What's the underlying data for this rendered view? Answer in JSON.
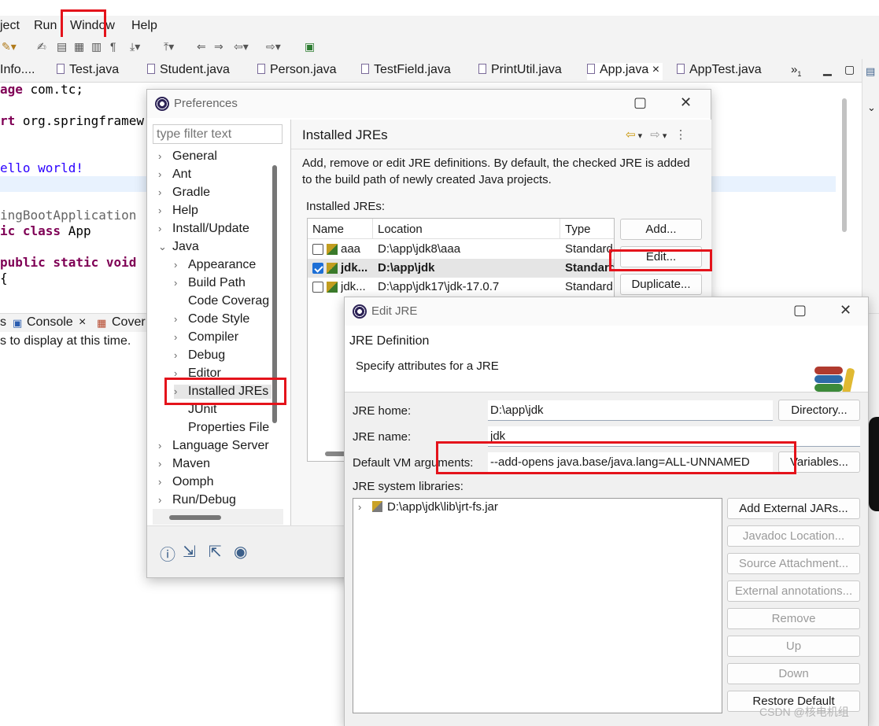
{
  "menu": {
    "project_fragment": "ject",
    "run": "Run",
    "window": "Window",
    "help": "Help"
  },
  "editor_tabs": [
    {
      "label": "Info...."
    },
    {
      "label": "Test.java"
    },
    {
      "label": "Student.java"
    },
    {
      "label": "Person.java"
    },
    {
      "label": "TestField.java"
    },
    {
      "label": "PrintUtil.java"
    },
    {
      "label": "App.java",
      "close": "×"
    },
    {
      "label": "AppTest.java"
    }
  ],
  "tab_overflow": "»",
  "tab_overflow_count": "1",
  "code": {
    "line1_kw": "age",
    "line1_rest": " com.tc;",
    "line2_kw": "rt",
    "line2_rest": " org.springframew",
    "line3": "ello world!",
    "line4": "ingBootApplication",
    "line5_kw": "ic class",
    "line5_rest": " App",
    "line6_kw": "public static void",
    "line7": "{"
  },
  "bottom_tabs": {
    "s": "s",
    "console": "Console",
    "console_close": "×",
    "coverage": "Cover"
  },
  "console_text": "s to display at this time.",
  "prefs": {
    "title": "Preferences",
    "filter_placeholder": "type filter text",
    "tree": [
      {
        "label": "General",
        "chev": "›"
      },
      {
        "label": "Ant",
        "chev": "›"
      },
      {
        "label": "Gradle",
        "chev": "›"
      },
      {
        "label": "Help",
        "chev": "›"
      },
      {
        "label": "Install/Update",
        "chev": "›"
      },
      {
        "label": "Java",
        "chev": "⌄"
      },
      {
        "label": "Appearance",
        "chev": "›"
      },
      {
        "label": "Build Path",
        "chev": "›"
      },
      {
        "label": "Code Coverag",
        "chev": ""
      },
      {
        "label": "Code Style",
        "chev": "›"
      },
      {
        "label": "Compiler",
        "chev": "›"
      },
      {
        "label": "Debug",
        "chev": "›"
      },
      {
        "label": "Editor",
        "chev": "›"
      },
      {
        "label": "Installed JREs",
        "chev": "›"
      },
      {
        "label": "JUnit",
        "chev": ""
      },
      {
        "label": "Properties File",
        "chev": ""
      },
      {
        "label": "Language Server",
        "chev": "›"
      },
      {
        "label": "Maven",
        "chev": "›"
      },
      {
        "label": "Oomph",
        "chev": "›"
      },
      {
        "label": "Run/Debug",
        "chev": "›"
      }
    ],
    "page_title": "Installed JREs",
    "description": "Add, remove or edit JRE definitions. By default, the checked JRE is added to the build path of newly created Java projects.",
    "installed_label": "Installed JREs:",
    "columns": {
      "name": "Name",
      "location": "Location",
      "type": "Type"
    },
    "rows": [
      {
        "name": "aaa",
        "location": "D:\\app\\jdk8\\aaa",
        "type": "Standard",
        "checked": false
      },
      {
        "name": "jdk...",
        "location": "D:\\app\\jdk",
        "type": "Standard",
        "checked": true
      },
      {
        "name": "jdk...",
        "location": "D:\\app\\jdk17\\jdk-17.0.7",
        "type": "Standard",
        "checked": false
      }
    ],
    "buttons": {
      "add": "Add...",
      "edit": "Edit...",
      "duplicate": "Duplicate..."
    }
  },
  "edit_jre": {
    "title": "Edit JRE",
    "heading": "JRE Definition",
    "subheading": "Specify attributes for a JRE",
    "jre_home_label": "JRE home:",
    "jre_home_value": "D:\\app\\jdk",
    "jre_name_label": "JRE name:",
    "jre_name_value": "jdk",
    "vm_args_label": "Default VM arguments:",
    "vm_args_value": "--add-opens java.base/java.lang=ALL-UNNAMED",
    "directory_button": "Directory...",
    "variables_button": "Variables...",
    "libraries_label": "JRE system libraries:",
    "library_item": "D:\\app\\jdk\\lib\\jrt-fs.jar",
    "buttons": {
      "add_external_jars": "Add External JARs...",
      "javadoc_location": "Javadoc Location...",
      "source_attachment": "Source Attachment...",
      "external_annotations": "External annotations...",
      "remove": "Remove",
      "up": "Up",
      "down": "Down",
      "restore_default": "Restore Default"
    }
  },
  "watermark": "CSDN @核电机组",
  "colors": {
    "highlight_box": "#e4131b",
    "checked_blue": "#1d6fd6",
    "keyword": "#7f0055"
  }
}
